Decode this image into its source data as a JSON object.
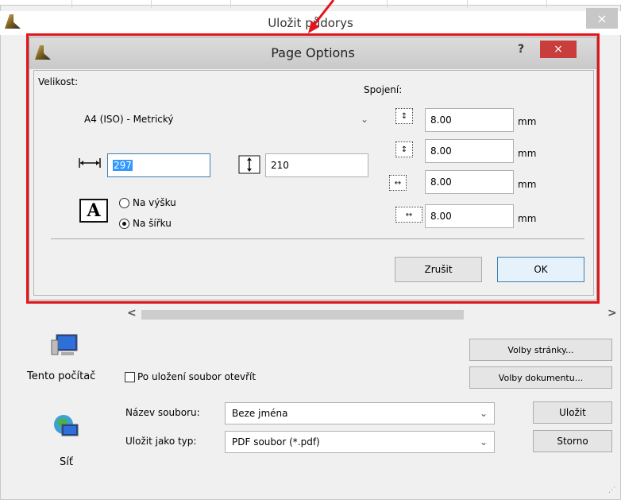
{
  "outer_window": {
    "title": "Uložit půdorys",
    "close_label": "×",
    "side_links": [
      {
        "label": "Tento počítač",
        "icon": "computer-icon"
      },
      {
        "label": "Síť",
        "icon": "network-icon"
      }
    ],
    "scroll_left": "<",
    "scroll_right": ">",
    "page_options_button": "Volby stránky...",
    "document_options_button": "Volby dokumentu...",
    "open_after_save_label": "Po uložení soubor otevřít",
    "open_after_save_checked": false,
    "file_name_label": "Název souboru:",
    "file_name_value": "Beze jména",
    "file_type_label": "Uložit jako typ:",
    "file_type_value": "PDF soubor (*.pdf)",
    "save_button": "Uložit",
    "cancel_button": "Storno"
  },
  "dialog": {
    "title": "Page Options",
    "help_label": "?",
    "close_label": "×",
    "size_label": "Velikost:",
    "size_value": "A4 (ISO) - Metrický",
    "width_value": "297",
    "height_value": "210",
    "orientation": {
      "portrait_label": "Na výšku",
      "landscape_label": "Na šířku",
      "selected": "landscape",
      "icon_letter": "A"
    },
    "margins_label": "Spojení:",
    "margins": [
      {
        "name": "top",
        "value": "8.00",
        "unit": "mm"
      },
      {
        "name": "bottom",
        "value": "8.00",
        "unit": "mm"
      },
      {
        "name": "left",
        "value": "8.00",
        "unit": "mm"
      },
      {
        "name": "right",
        "value": "8.00",
        "unit": "mm"
      }
    ],
    "cancel_button": "Zrušit",
    "ok_button": "OK"
  },
  "colors": {
    "highlight": "#e3141b",
    "dialog_close": "#c93d3d",
    "selection": "#3399ff"
  }
}
